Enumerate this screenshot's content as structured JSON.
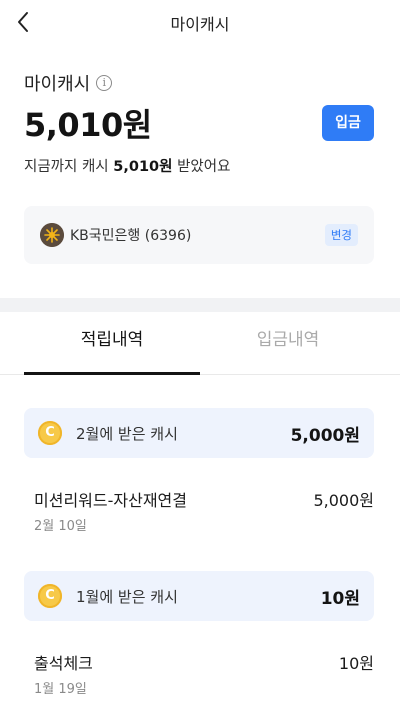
{
  "header": {
    "title": "마이캐시"
  },
  "summary": {
    "label": "마이캐시",
    "amount": "5,010원",
    "deposit_label": "입금",
    "text_before": "지금까지 캐시",
    "text_amount": "5,010원",
    "text_after": "받았어요"
  },
  "bank": {
    "name": "KB국민은행 (6396)",
    "change_label": "변경"
  },
  "tabs": [
    {
      "label": "적립내역",
      "active": true
    },
    {
      "label": "입금내역",
      "active": false
    }
  ],
  "months": [
    {
      "label": "2월에 받은 캐시",
      "total": "5,000원",
      "entries": [
        {
          "title": "미션리워드-자산재연결",
          "date": "2월 10일",
          "amount": "5,000원"
        }
      ]
    },
    {
      "label": "1월에 받은 캐시",
      "total": "10원",
      "entries": [
        {
          "title": "출석체크",
          "date": "1월 19일",
          "amount": "10원"
        }
      ]
    }
  ],
  "colors": {
    "accent": "#2f7cf6",
    "coin": "#f7c948",
    "month_bg": "#eef3fd"
  },
  "icons": {
    "back": "chevron-left-icon",
    "info": "info-icon",
    "bank": "bank-logo-icon",
    "coin": "coin-icon"
  }
}
